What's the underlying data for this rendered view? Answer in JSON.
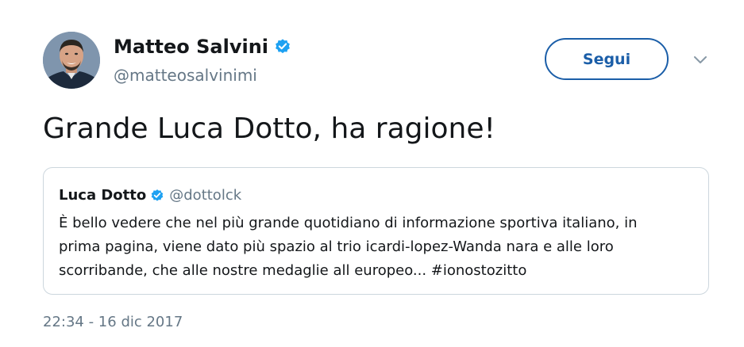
{
  "tweet": {
    "author": {
      "name": "Matteo Salvini",
      "handle": "@matteosalvinimi",
      "verified": true
    },
    "follow_label": "Segui",
    "text": "Grande Luca Dotto, ha ragione!",
    "timestamp": "22:34 - 16 dic 2017"
  },
  "quoted_tweet": {
    "author": {
      "name": "Luca Dotto",
      "handle": "@dottolck",
      "verified": true
    },
    "text_lines": [
      "È bello vedere che nel più grande quotidiano di informazione sportiva italiano, in",
      "prima pagina, viene dato più spazio al trio icardi-lopez-Wanda nara e alle loro",
      "scorribande, che alle nostre medaglie all europeo... #ionostozitto"
    ]
  },
  "icons": {
    "verified": "verified-badge-icon",
    "menu": "chevron-down-icon"
  },
  "colors": {
    "accent": "#1b5ea8",
    "verified": "#1da1f2",
    "secondary_text": "#657786",
    "border": "#ccd6dd"
  }
}
